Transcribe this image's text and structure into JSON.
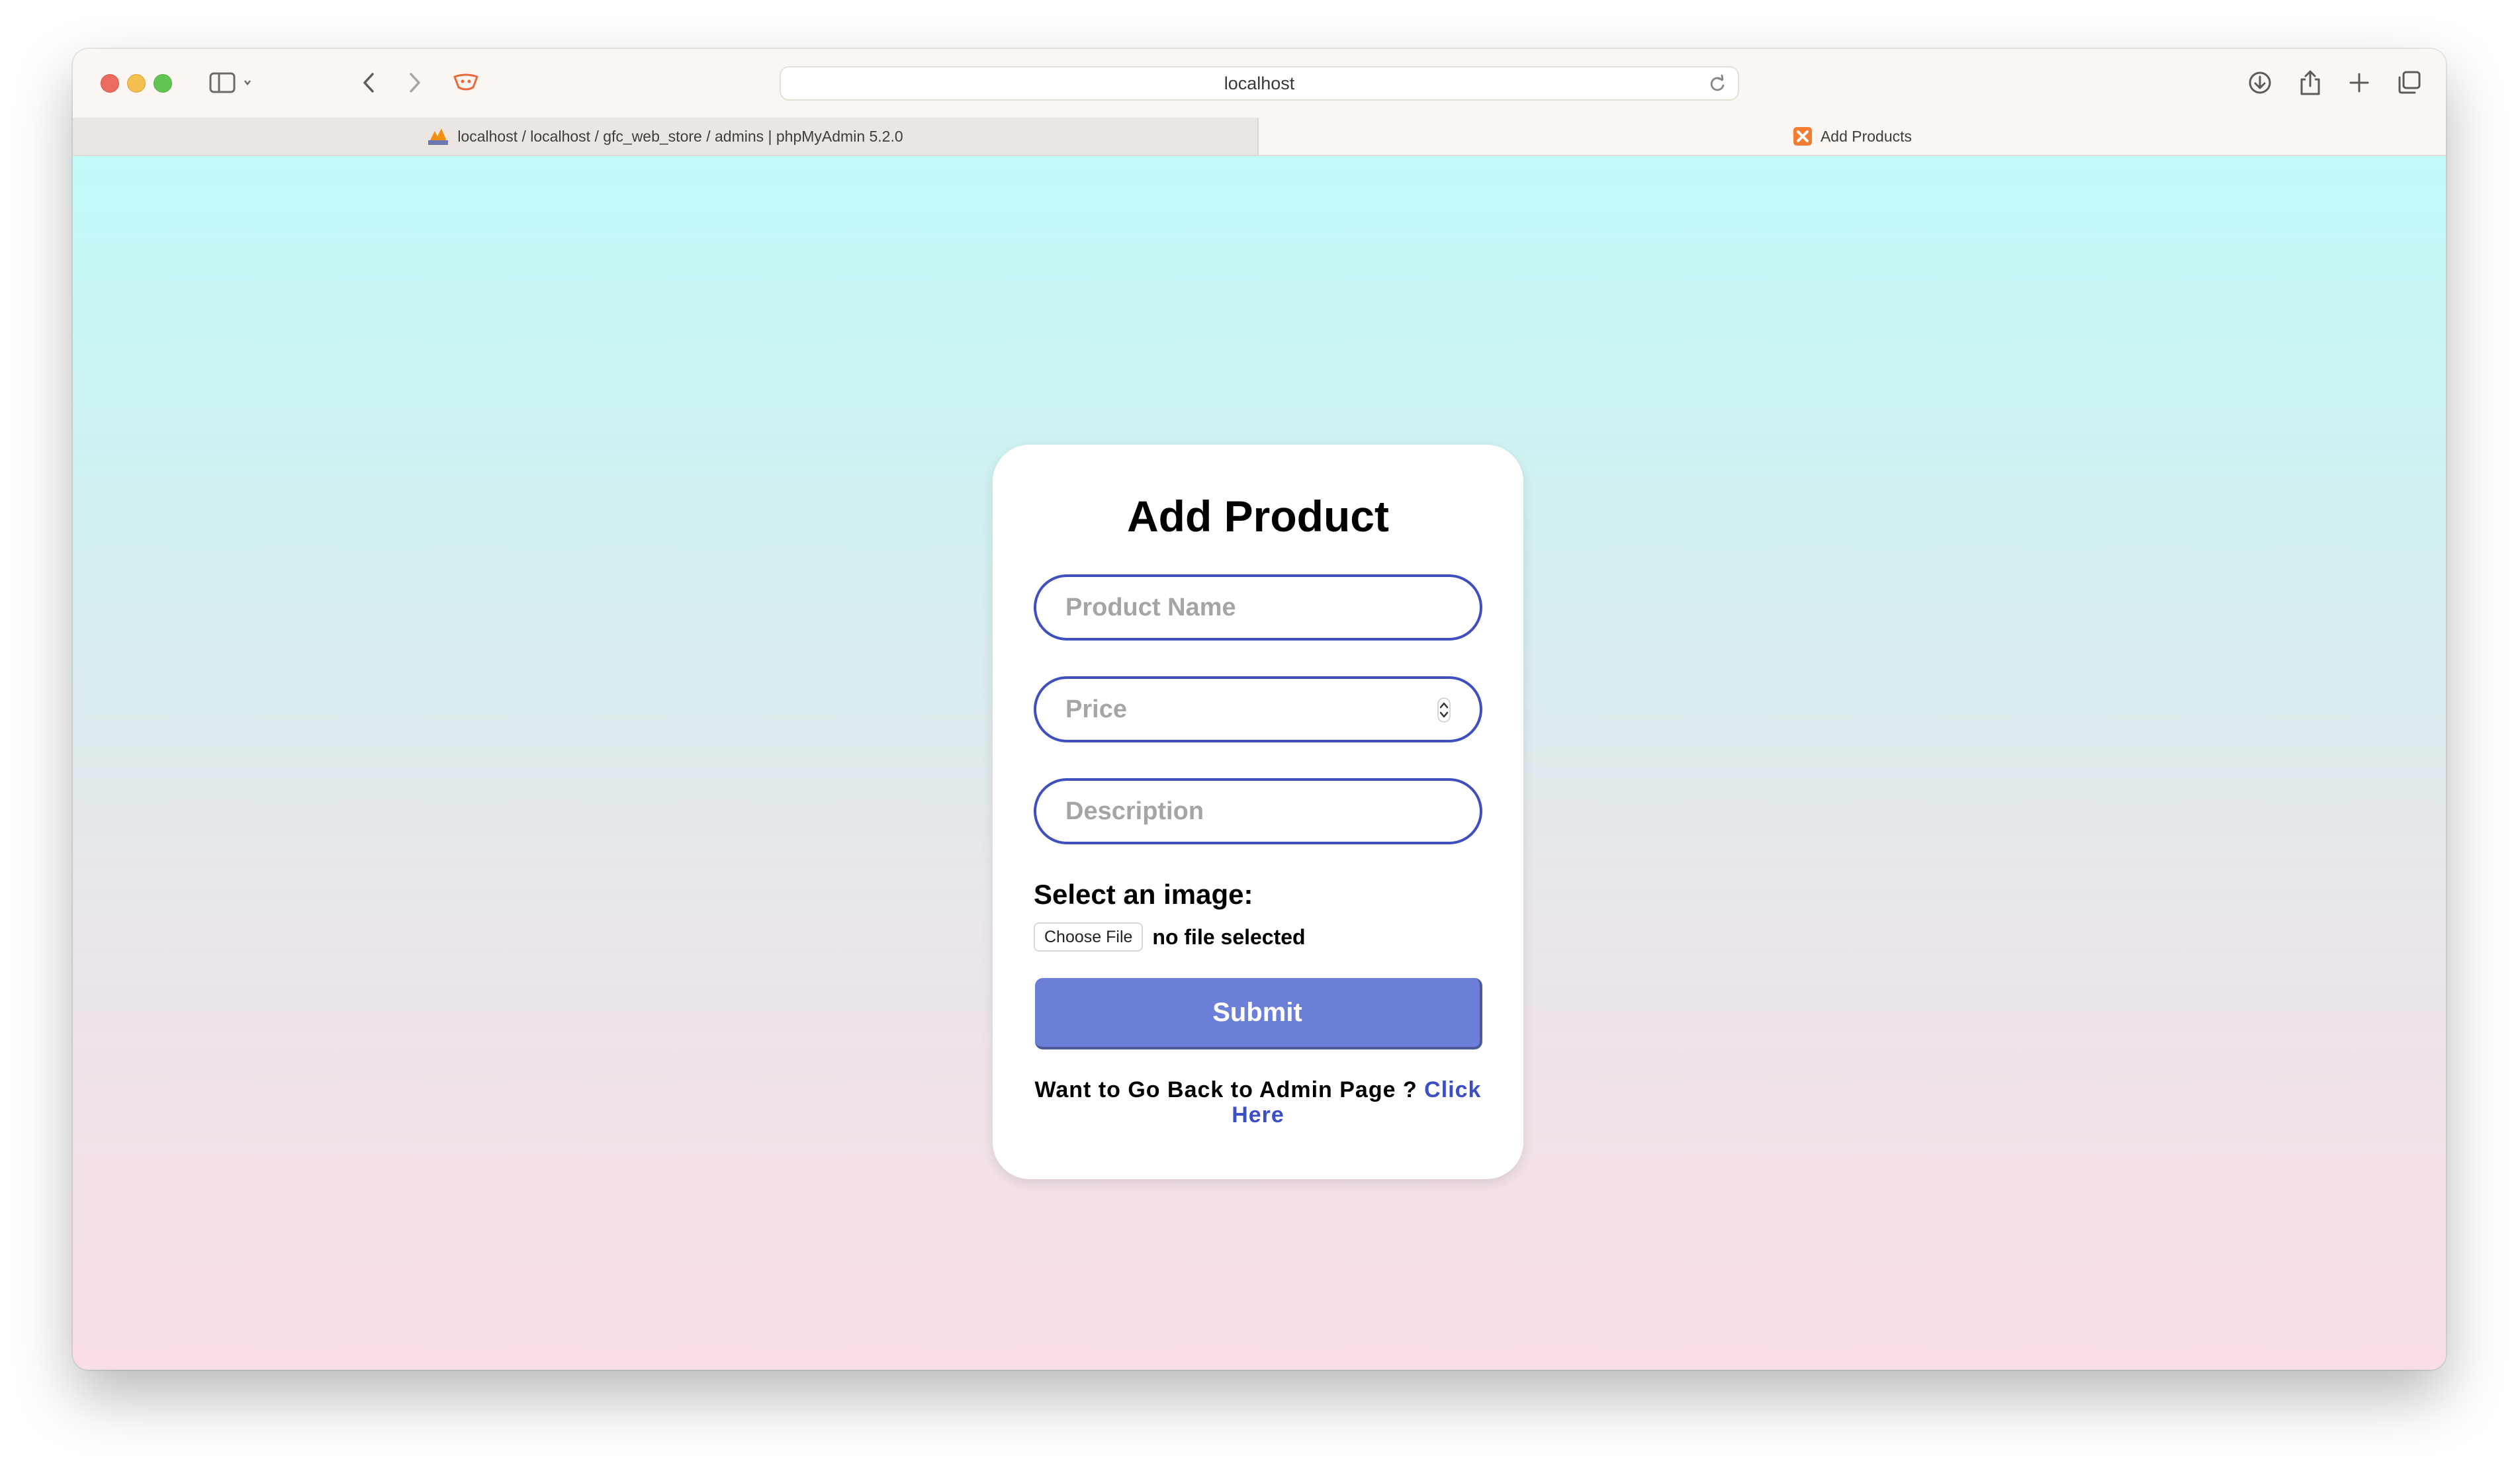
{
  "browser": {
    "address": "localhost",
    "tabs": [
      {
        "label": "localhost / localhost / gfc_web_store / admins | phpMyAdmin 5.2.0",
        "active": false
      },
      {
        "label": "Add Products",
        "active": true
      }
    ]
  },
  "form": {
    "title": "Add Product",
    "name_placeholder": "Product Name",
    "price_placeholder": "Price",
    "description_placeholder": "Description",
    "image_label": "Select an image:",
    "choose_file_label": "Choose File",
    "file_status": "no file selected",
    "submit_label": "Submit",
    "back_text": "Want to Go Back to Admin Page ?",
    "back_link": "Click Here"
  },
  "colors": {
    "accent": "#3f4fc0",
    "submit": "#6b7fd8",
    "gradient_top": "#c2fbf9",
    "gradient_bottom": "#f9dde7"
  }
}
